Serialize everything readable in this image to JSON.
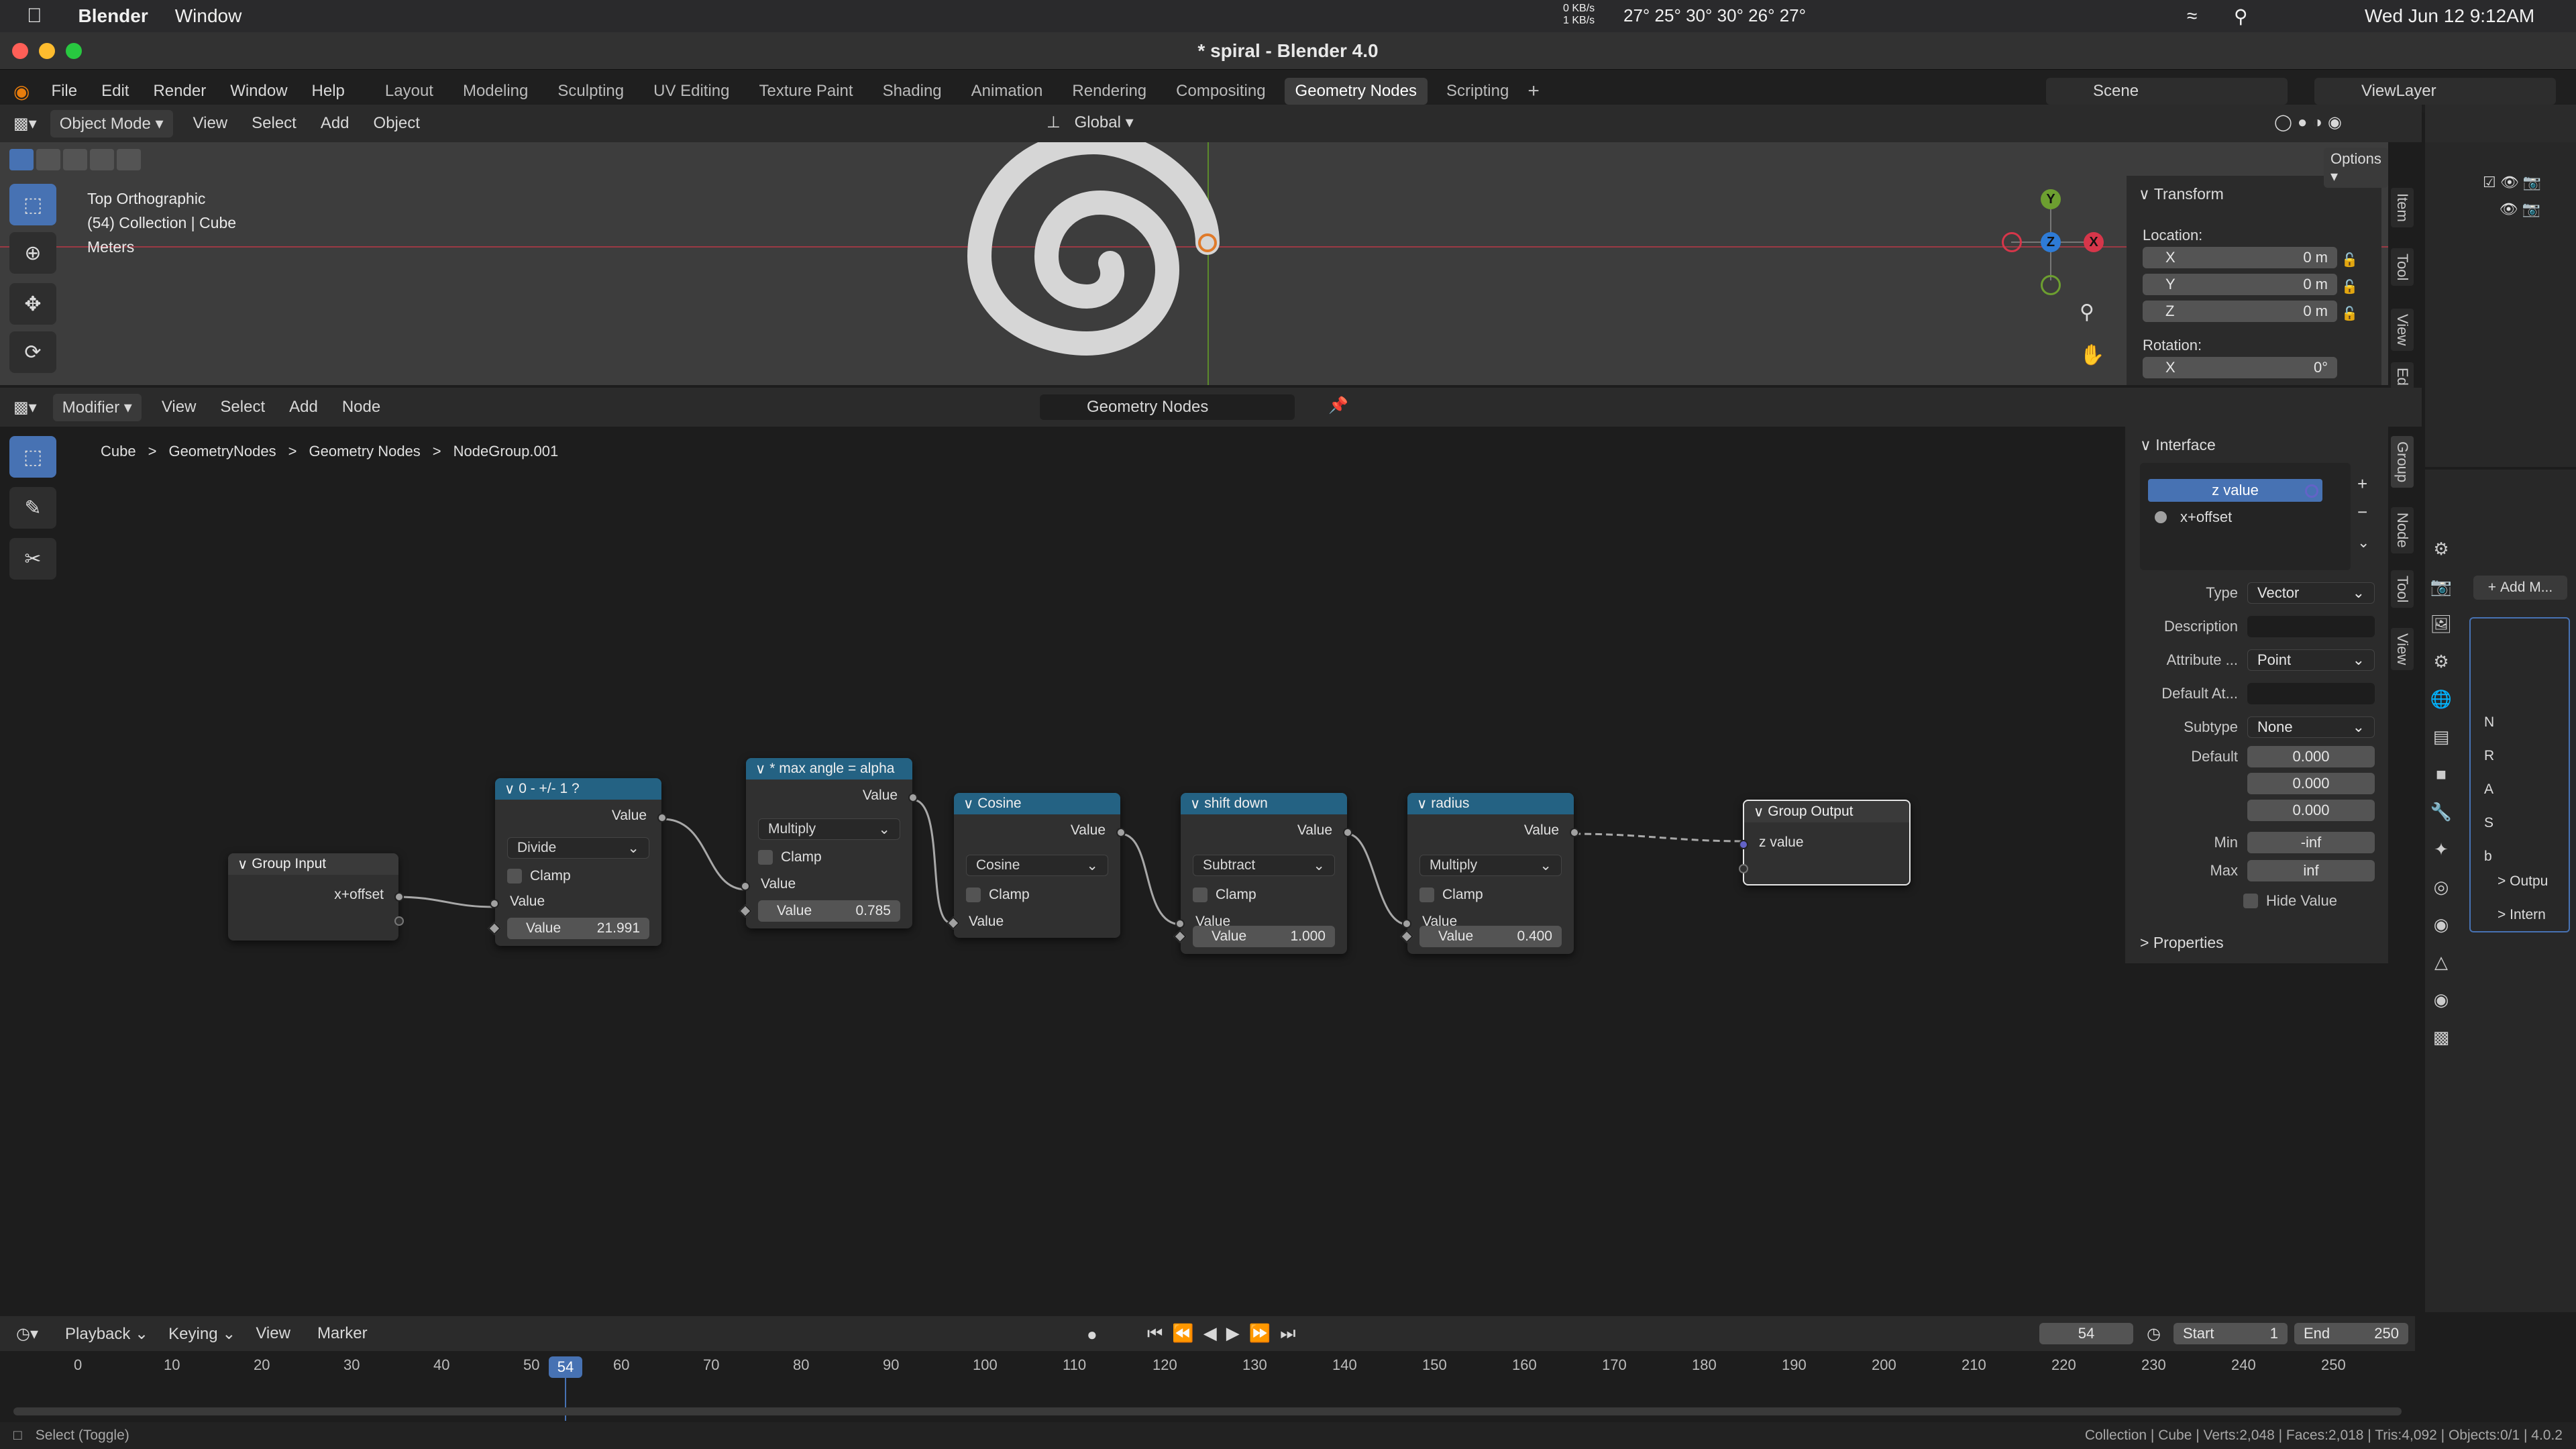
{
  "menubar": {
    "app": "Blender",
    "menu": "Window",
    "net_up": "0 KB/s",
    "net_down": "1 KB/s",
    "temps": "27° 25° 30° 30° 26° 27°",
    "datetime": "Wed Jun 12  9:12AM"
  },
  "window": {
    "title": "* spiral - Blender 4.0"
  },
  "topbar": {
    "menus": [
      "File",
      "Edit",
      "Render",
      "Window",
      "Help"
    ],
    "workspaces": [
      "Layout",
      "Modeling",
      "Sculpting",
      "UV Editing",
      "Texture Paint",
      "Shading",
      "Animation",
      "Rendering",
      "Compositing",
      "Geometry Nodes",
      "Scripting"
    ],
    "active_workspace": "Geometry Nodes",
    "scene": "Scene",
    "view_layer": "ViewLayer"
  },
  "viewport": {
    "mode": "Object Mode",
    "menus": [
      "View",
      "Select",
      "Add",
      "Object"
    ],
    "transform_orientation": "Global",
    "options": "Options",
    "overlay_line1": "Top Orthographic",
    "overlay_line2": "(54) Collection | Cube",
    "overlay_line3": "Meters",
    "gizmo_y": "Y",
    "gizmo_z": "Z",
    "gizmo_x": "X"
  },
  "n_panel": {
    "title": "Transform",
    "location_label": "Location:",
    "x_label": "X",
    "x_val": "0 m",
    "y_label": "Y",
    "y_val": "0 m",
    "z_label": "Z",
    "z_val": "0 m",
    "rotation_label": "Rotation:",
    "rx_label": "X",
    "rx_val": "0°",
    "tabs": [
      "Item",
      "Tool",
      "View",
      "Ed"
    ]
  },
  "node_editor": {
    "type_menu": "Modifier",
    "menus": [
      "View",
      "Select",
      "Add",
      "Node"
    ],
    "tree_name": "Geometry Nodes",
    "breadcrumb": [
      "Cube",
      "GeometryNodes",
      "Geometry Nodes",
      "NodeGroup.001"
    ],
    "side_tabs": [
      "Group",
      "Node",
      "Tool",
      "View"
    ]
  },
  "nodes": {
    "group_input": {
      "title": "Group Input",
      "out": "x+offset"
    },
    "divide": {
      "title": "0 - +/- 1 ?",
      "out": "Value",
      "op": "Divide",
      "clamp": "Clamp",
      "in": "Value",
      "val_label": "Value",
      "val": "21.991"
    },
    "maxangle": {
      "title": "* max angle = alpha",
      "out": "Value",
      "op": "Multiply",
      "clamp": "Clamp",
      "in": "Value",
      "val_label": "Value",
      "val": "0.785"
    },
    "cosine": {
      "title": "Cosine",
      "out": "Value",
      "op": "Cosine",
      "clamp": "Clamp",
      "in": "Value"
    },
    "shift": {
      "title": "shift down",
      "out": "Value",
      "op": "Subtract",
      "clamp": "Clamp",
      "in": "Value",
      "val_label": "Value",
      "val": "1.000"
    },
    "radius": {
      "title": "radius",
      "out": "Value",
      "op": "Multiply",
      "clamp": "Clamp",
      "in": "Value",
      "val_label": "Value",
      "val": "0.400"
    },
    "group_output": {
      "title": "Group Output",
      "in": "z value"
    }
  },
  "interface_panel": {
    "title": "Interface",
    "items": [
      "z value",
      "x+offset"
    ],
    "type_label": "Type",
    "type_val": "Vector",
    "desc_label": "Description",
    "attr_label": "Attribute ...",
    "attr_val": "Point",
    "default_attr_label": "Default At...",
    "subtype_label": "Subtype",
    "subtype_val": "None",
    "default_label": "Default",
    "default_vals": [
      "0.000",
      "0.000",
      "0.000"
    ],
    "min_label": "Min",
    "min_val": "-inf",
    "max_label": "Max",
    "max_val": "inf",
    "hide_value": "Hide Value",
    "properties": "Properties"
  },
  "properties_editor": {
    "add_modifier": "Add M...",
    "rows": [
      "N",
      "R",
      "A",
      "S",
      "b"
    ],
    "output_label": "Outpu",
    "internal_label": "Intern"
  },
  "timeline": {
    "menus": [
      "Playback",
      "Keying",
      "View",
      "Marker"
    ],
    "current_frame": "54",
    "start_label": "Start",
    "start": "1",
    "end_label": "End",
    "end": "250",
    "ticks": [
      "0",
      "10",
      "20",
      "30",
      "40",
      "50",
      "60",
      "70",
      "80",
      "90",
      "100",
      "110",
      "120",
      "130",
      "140",
      "150",
      "160",
      "170",
      "180",
      "190",
      "200",
      "210",
      "220",
      "230",
      "240",
      "250"
    ]
  },
  "statusbar": {
    "left": "Select (Toggle)",
    "right": "Collection | Cube | Verts:2,048 | Faces:2,018 | Tris:4,092 | Objects:0/1 | 4.0.2"
  },
  "colors": {
    "accent": "#4772b3",
    "node_header": "#246283",
    "frame_marker": "#4772b3"
  }
}
